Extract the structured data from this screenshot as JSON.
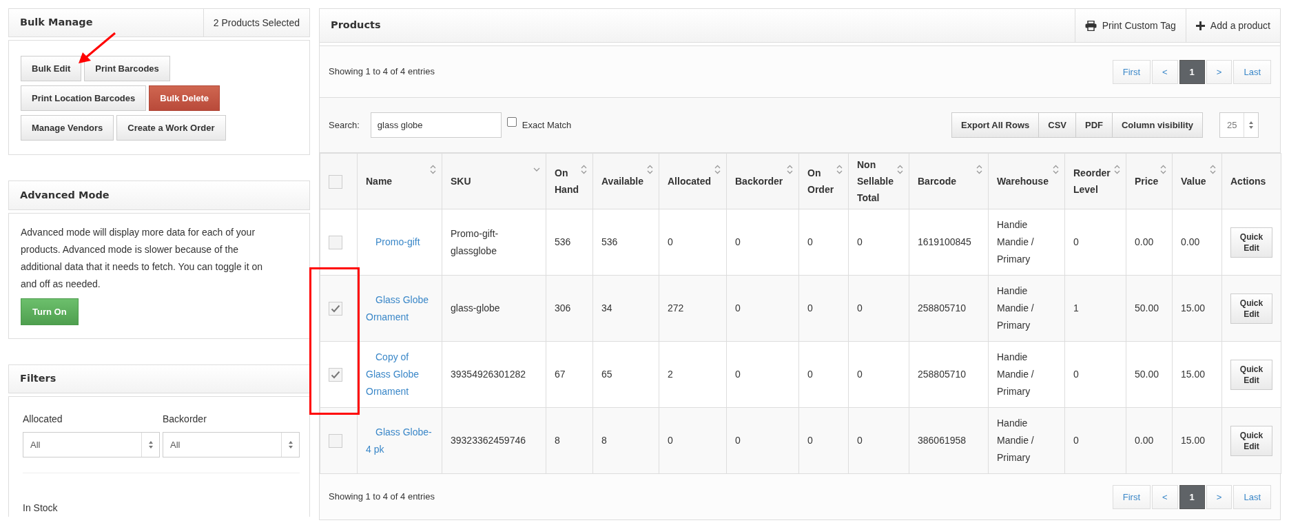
{
  "bulk_manage": {
    "title": "Bulk Manage",
    "selected_count": "2 Products Selected",
    "buttons": [
      {
        "label": "Bulk Edit",
        "kind": "default"
      },
      {
        "label": "Print Barcodes",
        "kind": "default"
      },
      {
        "label": "Print Location Barcodes",
        "kind": "default"
      },
      {
        "label": "Bulk Delete",
        "kind": "danger"
      },
      {
        "label": "Manage Vendors",
        "kind": "default"
      },
      {
        "label": "Create a Work Order",
        "kind": "default"
      }
    ]
  },
  "advanced_mode": {
    "title": "Advanced Mode",
    "description": "Advanced mode will display more data for each of your products. Advanced mode is slower because of the additional data that it needs to fetch. You can toggle it on and off as needed.",
    "button": "Turn On"
  },
  "filters": {
    "title": "Filters",
    "fields": [
      {
        "label": "Allocated",
        "value": "All"
      },
      {
        "label": "Backorder",
        "value": "All"
      }
    ],
    "section_label": "In Stock"
  },
  "products": {
    "title": "Products",
    "header_actions": [
      {
        "label": "Print Custom Tag",
        "kind": "print"
      },
      {
        "label": "Add a product",
        "kind": "add"
      }
    ],
    "info_top": "Showing 1 to 4 of 4 entries",
    "pagination_top": [
      {
        "label": "First",
        "selected": false
      },
      {
        "label": "<",
        "selected": false
      },
      {
        "label": "1",
        "selected": true
      },
      {
        "label": ">",
        "selected": false
      },
      {
        "label": "Last",
        "selected": false
      }
    ],
    "search": {
      "label": "Search:",
      "value": "glass globe"
    },
    "exact_match": {
      "label": "Exact Match",
      "checked": false
    },
    "export_buttons": [
      "Export All Rows",
      "CSV",
      "PDF",
      "Column visibility"
    ],
    "page_length": "25",
    "table": {
      "select_all_checked": false,
      "columns": [
        {
          "label": "Name",
          "sortable": true,
          "sorted_descending": false
        },
        {
          "label": "SKU",
          "sortable": true,
          "sorted_descending": true
        },
        {
          "label": "On Hand",
          "sortable": true,
          "sorted_descending": false
        },
        {
          "label": "Available",
          "sortable": true,
          "sorted_descending": false
        },
        {
          "label": "Allocated",
          "sortable": true,
          "sorted_descending": false
        },
        {
          "label": "Backorder",
          "sortable": true,
          "sorted_descending": false
        },
        {
          "label": "On Order",
          "sortable": true,
          "sorted_descending": false
        },
        {
          "label": "Non Sellable Total",
          "sortable": true,
          "sorted_descending": false
        },
        {
          "label": "Barcode",
          "sortable": true,
          "sorted_descending": false
        },
        {
          "label": "Warehouse",
          "sortable": true,
          "sorted_descending": false
        },
        {
          "label": "Reorder Level",
          "sortable": true,
          "sorted_descending": false
        },
        {
          "label": "Price",
          "sortable": true,
          "sorted_descending": false
        },
        {
          "label": "Value",
          "sortable": true,
          "sorted_descending": false
        },
        {
          "label": "Actions",
          "sortable": false
        }
      ],
      "rows": [
        {
          "selected": false,
          "cells": [
            "Promo-gift",
            "Promo-gift-glassglobe",
            "536",
            "536",
            "0",
            "0",
            "0",
            "0",
            "1619100845",
            "Handie Mandie / Primary",
            "0",
            "0.00",
            "0.00"
          ],
          "action": "Quick Edit"
        },
        {
          "selected": true,
          "cells": [
            "Glass Globe Ornament",
            "glass-globe",
            "306",
            "34",
            "272",
            "0",
            "0",
            "0",
            "258805710",
            "Handie Mandie / Primary",
            "1",
            "50.00",
            "15.00"
          ],
          "action": "Quick Edit"
        },
        {
          "selected": true,
          "cells": [
            "Copy of Glass Globe Ornament",
            "39354926301282",
            "67",
            "65",
            "2",
            "0",
            "0",
            "0",
            "258805710",
            "Handie Mandie / Primary",
            "0",
            "50.00",
            "15.00"
          ],
          "action": "Quick Edit"
        },
        {
          "selected": false,
          "cells": [
            "Glass Globe-4 pk",
            "39323362459746",
            "8",
            "8",
            "0",
            "0",
            "0",
            "0",
            "386061958",
            "Handie Mandie / Primary",
            "0",
            "0.00",
            "15.00"
          ],
          "action": "Quick Edit"
        }
      ]
    },
    "info_bottom": "Showing 1 to 4 of 4 entries",
    "pagination_bottom": [
      {
        "label": "First",
        "selected": false
      },
      {
        "label": "<",
        "selected": false
      },
      {
        "label": "1",
        "selected": true
      },
      {
        "label": ">",
        "selected": false
      },
      {
        "label": "Last",
        "selected": false
      }
    ]
  }
}
